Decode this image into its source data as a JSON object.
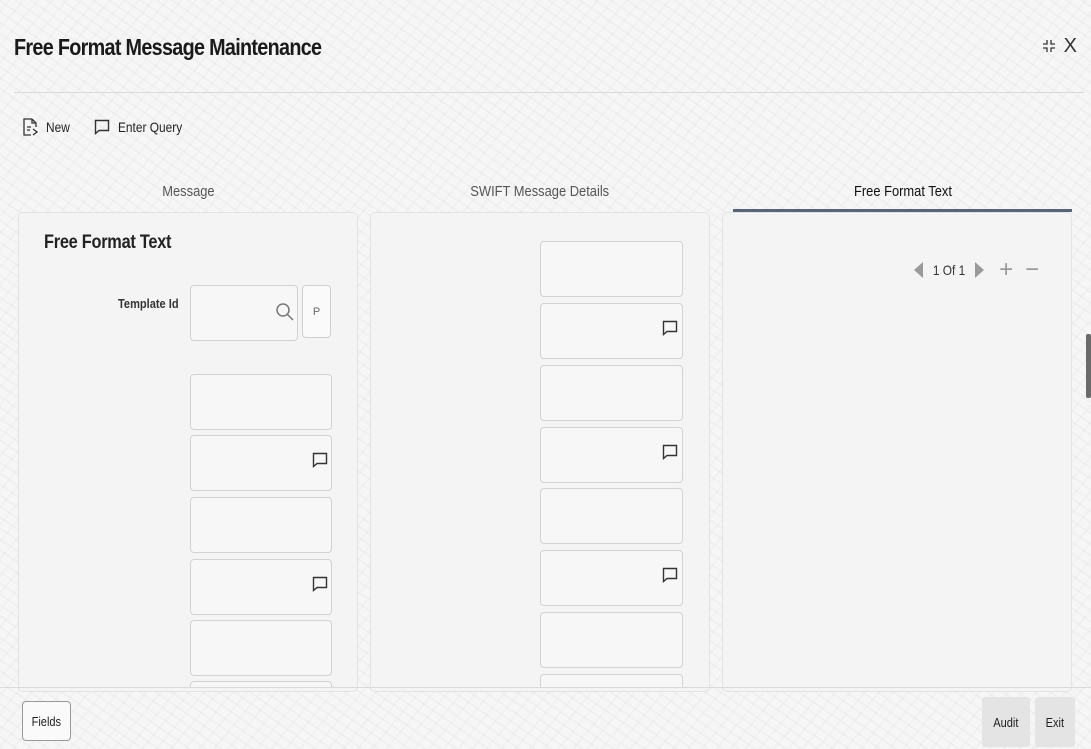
{
  "window": {
    "title": "Free Format Message Maintenance",
    "close_label": "X"
  },
  "toolbar": {
    "new_label": "New",
    "enter_query_label": "Enter Query"
  },
  "tabs": [
    {
      "label": "Message",
      "active": false
    },
    {
      "label": "SWIFT Message Details",
      "active": false
    },
    {
      "label": "Free Format Text",
      "active": true
    }
  ],
  "message_panel": {
    "section_title": "Free Format Text",
    "template_id_label": "Template Id",
    "template_id_value": "",
    "p_button_label": "P"
  },
  "pager": {
    "text": "1 Of 1",
    "add_label": "+",
    "remove_label": "−"
  },
  "footer": {
    "fields_label": "Fields",
    "audit_label": "Audit",
    "exit_label": "Exit"
  },
  "colors": {
    "active_tab_underline": "#5a6478",
    "pager_arrows": "#9a9a9a"
  }
}
